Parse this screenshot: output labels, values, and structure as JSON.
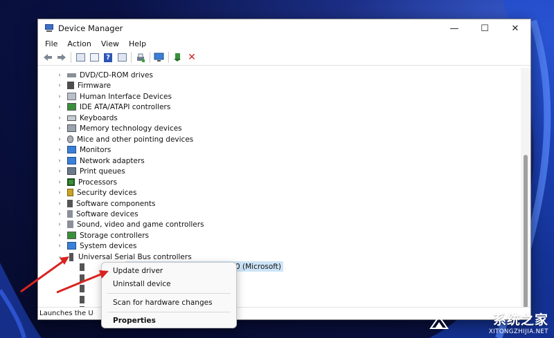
{
  "window": {
    "title": "Device Manager",
    "minimize": "—",
    "maximize": "☐",
    "close": "✕"
  },
  "menu": [
    "File",
    "Action",
    "View",
    "Help"
  ],
  "tree": [
    "DVD/CD-ROM drives",
    "Firmware",
    "Human Interface Devices",
    "IDE ATA/ATAPI controllers",
    "Keyboards",
    "Memory technology devices",
    "Mice and other pointing devices",
    "Monitors",
    "Network adapters",
    "Print queues",
    "Processors",
    "Security devices",
    "Software components",
    "Software devices",
    "Sound, video and game controllers",
    "Storage controllers",
    "System devices",
    "Universal Serial Bus controllers"
  ],
  "selected_child_text": ".0 (Microsoft)",
  "context_menu": {
    "update": "Update driver",
    "uninstall": "Uninstall device",
    "scan": "Scan for hardware changes",
    "properties": "Properties"
  },
  "status": "Launches the U",
  "watermark": {
    "zh": "系统之家",
    "en": "XITONGZHIJIA.NET"
  },
  "colors": {
    "accent": "#cce4f7",
    "arrow": "#d9231f"
  }
}
